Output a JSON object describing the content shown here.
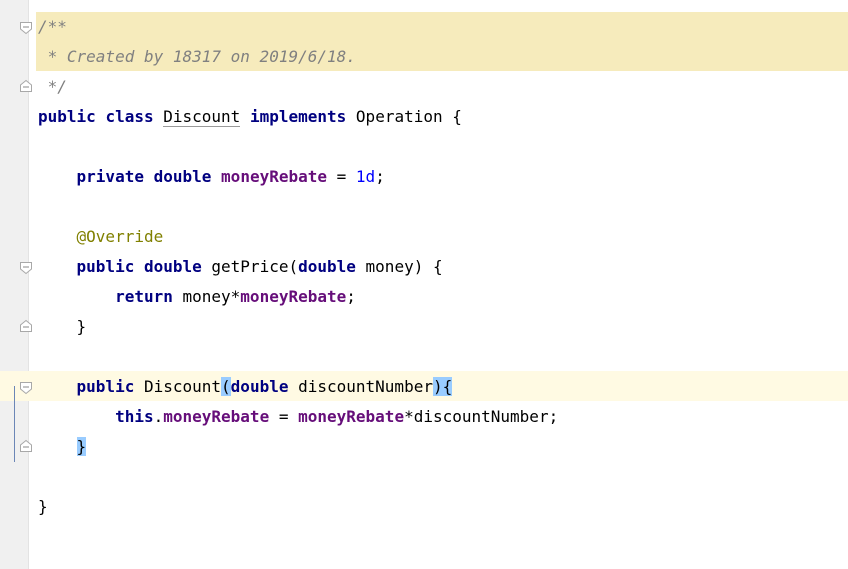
{
  "editor": {
    "code": {
      "doc_open": "/**",
      "doc_created": " * Created by 18317 on 2019/6/18.",
      "doc_close": " */",
      "l4_kw1": "public",
      "l4_kw2": "class",
      "l4_name": "Discount",
      "l4_kw3": "implements",
      "l4_iface": "Operation",
      "l4_brace": "{",
      "l6_kw1": "private",
      "l6_kw2": "double",
      "l6_field": "moneyRebate",
      "l6_eq": " = ",
      "l6_num": "1d",
      "l6_semi": ";",
      "l8_annotation": "@Override",
      "l9_kw1": "public",
      "l9_kw2": "double",
      "l9_method": "getPrice(",
      "l9_kw3": "double",
      "l9_param": " money) {",
      "l10_kw": "return",
      "l10_expr": " money*",
      "l10_field": "moneyRebate",
      "l10_semi": ";",
      "l11_close": "}",
      "l13_kw1": "public",
      "l13_name": "Discount",
      "l13_lparen": "(",
      "l13_kw2": "double",
      "l13_param": " discountNumber",
      "l13_rparen": ")",
      "l13_brace": "{",
      "l14_kw": "this",
      "l14_dot": ".",
      "l14_field1": "moneyRebate",
      "l14_eq": " = ",
      "l14_field2": "moneyRebate",
      "l14_expr": "*discountNumber;",
      "l15_close": "}",
      "l17_close": "}"
    },
    "colors": {
      "keyword": "#000080",
      "comment": "#808080",
      "annotation": "#808000",
      "field": "#660e7a",
      "number": "#0000ff",
      "doc_background": "#f6ebbc",
      "caret_line": "#fffae3",
      "brace_match": "#99ccff"
    },
    "gutter_icons": [
      "fold-start-icon",
      "fold-end-icon"
    ]
  }
}
